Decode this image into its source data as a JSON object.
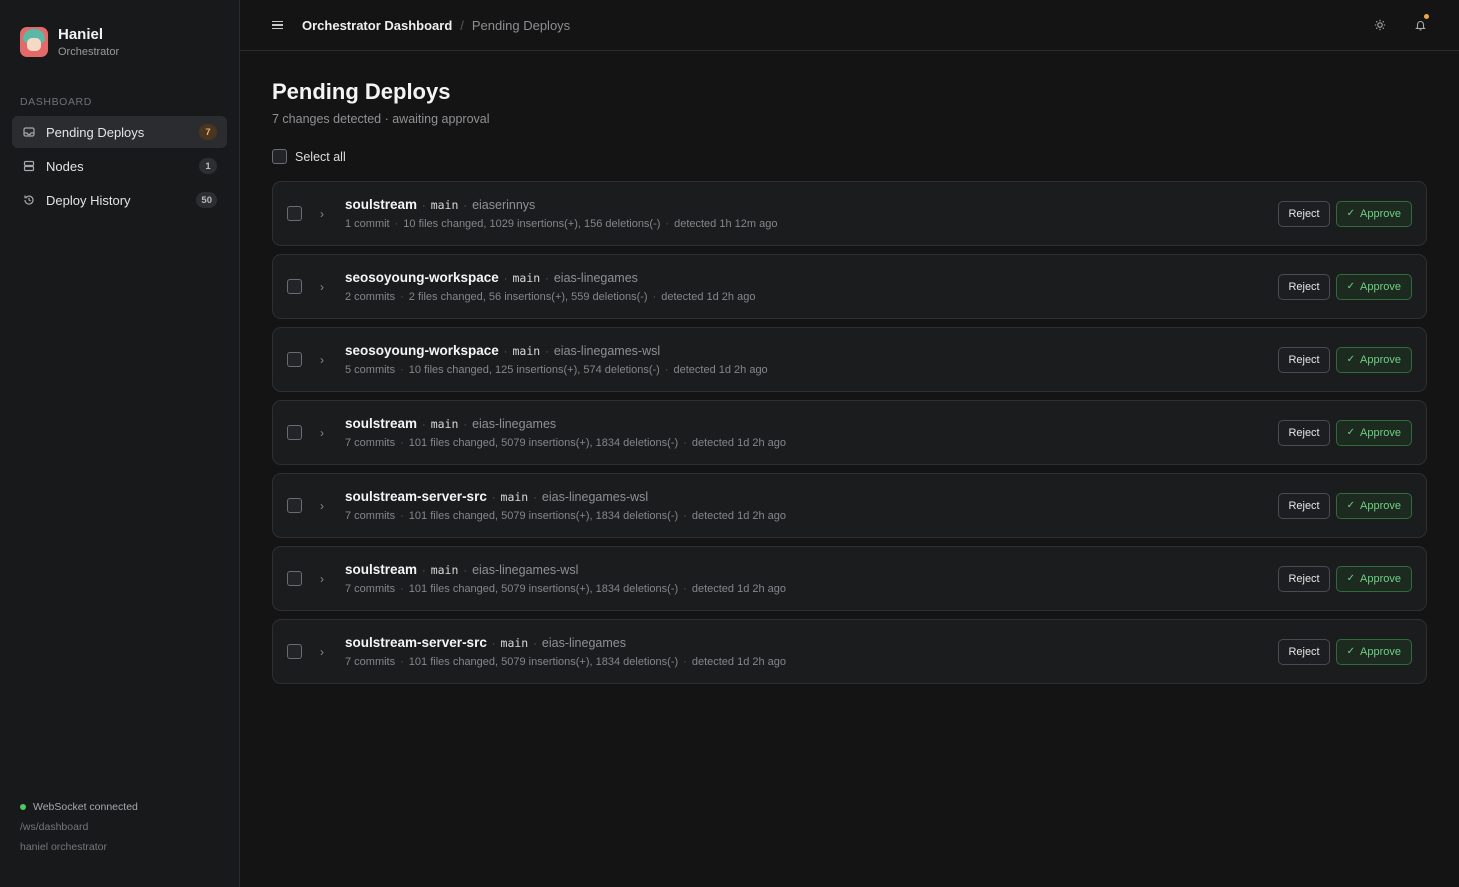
{
  "brand": {
    "name": "Haniel",
    "subtitle": "Orchestrator"
  },
  "sidebar": {
    "section_label": "DASHBOARD",
    "items": [
      {
        "label": "Pending Deploys",
        "badge": "7",
        "icon": "inbox-icon",
        "active": true
      },
      {
        "label": "Nodes",
        "badge": "1",
        "icon": "server-icon",
        "active": false
      },
      {
        "label": "Deploy History",
        "badge": "50",
        "icon": "history-icon",
        "active": false
      }
    ],
    "footer": {
      "ws_status": "WebSocket connected",
      "ws_path": "/ws/dashboard",
      "app_label": "haniel orchestrator"
    }
  },
  "topbar": {
    "breadcrumb_root": "Orchestrator Dashboard",
    "breadcrumb_sep": "/",
    "breadcrumb_current": "Pending Deploys",
    "icons": [
      "sun-icon",
      "bell-icon"
    ]
  },
  "page": {
    "title": "Pending Deploys",
    "subtitle": "7 changes detected · awaiting approval",
    "select_all_label": "Select all"
  },
  "actions": {
    "reject_label": "Reject",
    "approve_label": "Approve",
    "approve_check": "✓"
  },
  "deploys": [
    {
      "repo": "soulstream",
      "branch": "main",
      "host": "eiaserinnys",
      "commits": "1 commit",
      "changes": "10 files changed, 1029 insertions(+), 156 deletions(-)",
      "detected": "detected 1h 12m ago"
    },
    {
      "repo": "seosoyoung-workspace",
      "branch": "main",
      "host": "eias-linegames",
      "commits": "2 commits",
      "changes": "2 files changed, 56 insertions(+), 559 deletions(-)",
      "detected": "detected 1d 2h ago"
    },
    {
      "repo": "seosoyoung-workspace",
      "branch": "main",
      "host": "eias-linegames-wsl",
      "commits": "5 commits",
      "changes": "10 files changed, 125 insertions(+), 574 deletions(-)",
      "detected": "detected 1d 2h ago"
    },
    {
      "repo": "soulstream",
      "branch": "main",
      "host": "eias-linegames",
      "commits": "7 commits",
      "changes": "101 files changed, 5079 insertions(+), 1834 deletions(-)",
      "detected": "detected 1d 2h ago"
    },
    {
      "repo": "soulstream-server-src",
      "branch": "main",
      "host": "eias-linegames-wsl",
      "commits": "7 commits",
      "changes": "101 files changed, 5079 insertions(+), 1834 deletions(-)",
      "detected": "detected 1d 2h ago"
    },
    {
      "repo": "soulstream",
      "branch": "main",
      "host": "eias-linegames-wsl",
      "commits": "7 commits",
      "changes": "101 files changed, 5079 insertions(+), 1834 deletions(-)",
      "detected": "detected 1d 2h ago"
    },
    {
      "repo": "soulstream-server-src",
      "branch": "main",
      "host": "eias-linegames",
      "commits": "7 commits",
      "changes": "101 files changed, 5079 insertions(+), 1834 deletions(-)",
      "detected": "detected 1d 2h ago"
    }
  ],
  "colors": {
    "accent_green": "#6fcf83",
    "badge_warn": "#e8b173",
    "status_dot": "#4cc764",
    "notif_dot": "#f0a640"
  }
}
